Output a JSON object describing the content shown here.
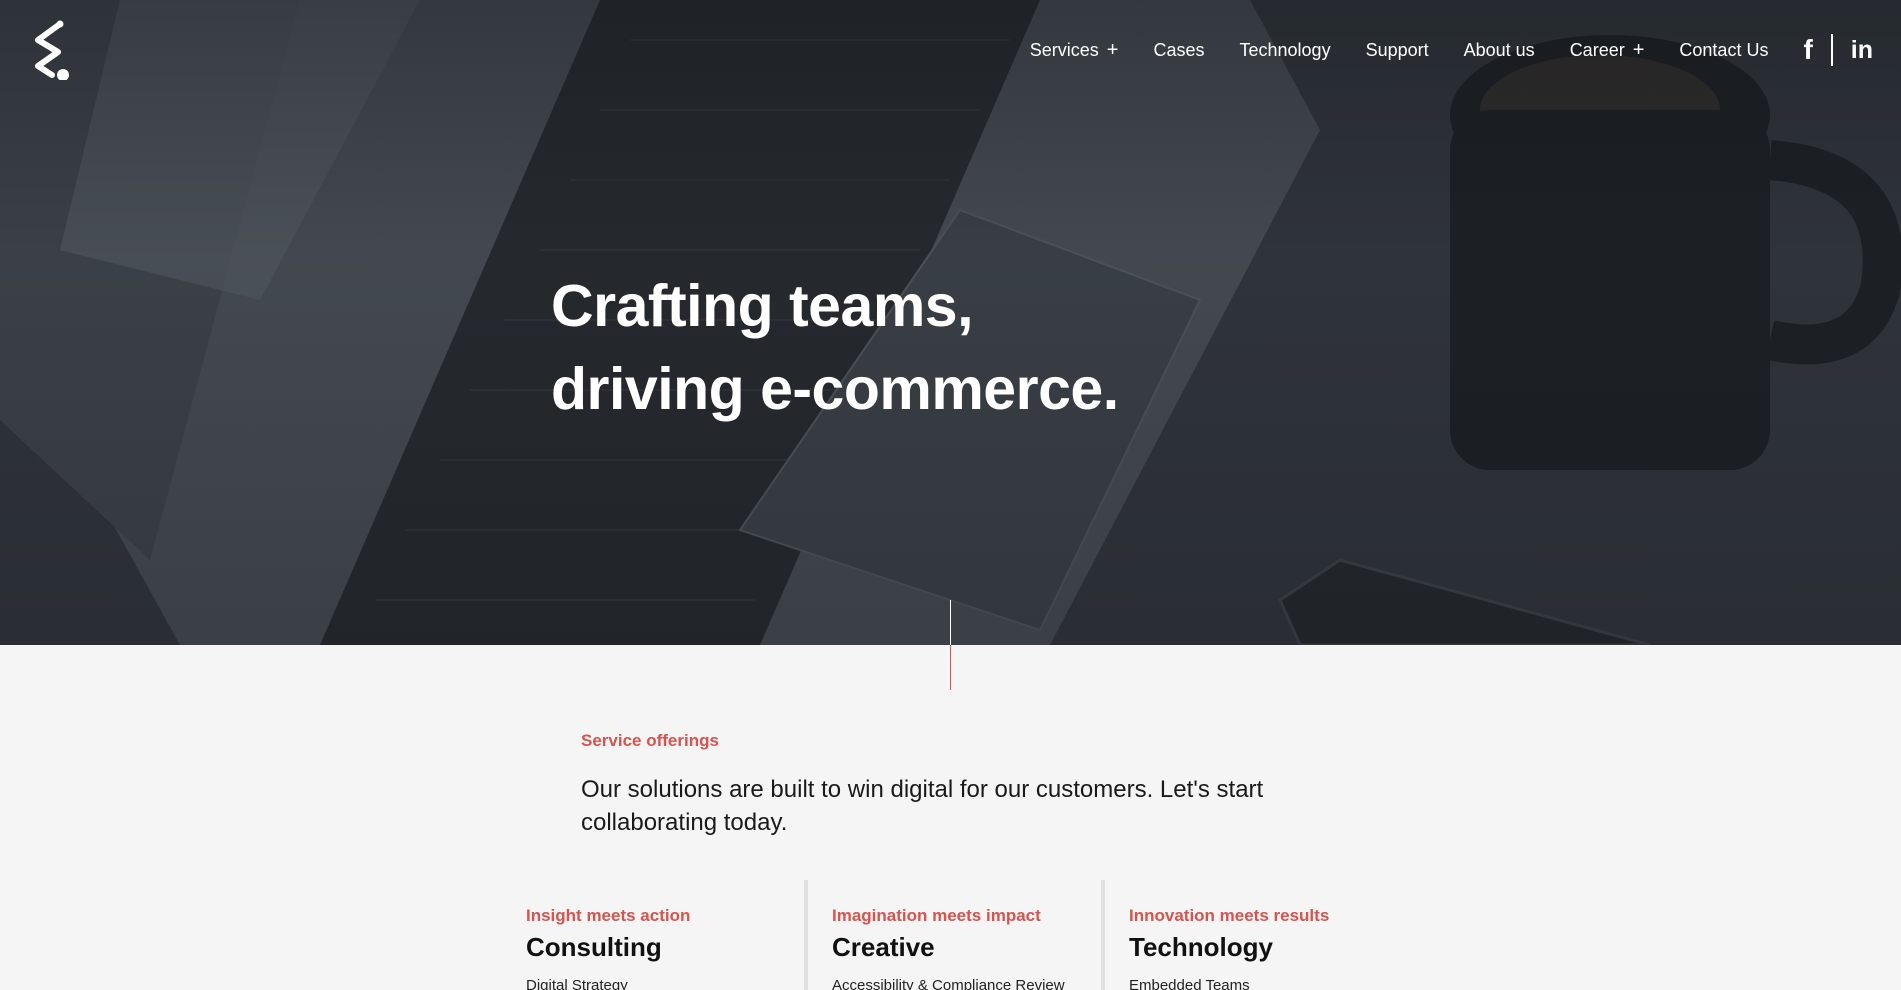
{
  "header": {
    "logo_name": "company-logo",
    "nav": [
      {
        "label": "Services",
        "has_submenu": true,
        "submenu_icon": "+"
      },
      {
        "label": "Cases",
        "has_submenu": false
      },
      {
        "label": "Technology",
        "has_submenu": false
      },
      {
        "label": "Support",
        "has_submenu": false
      },
      {
        "label": "About us",
        "has_submenu": false
      },
      {
        "label": "Career",
        "has_submenu": true,
        "submenu_icon": "+"
      },
      {
        "label": "Contact Us",
        "has_submenu": false
      }
    ],
    "social": {
      "facebook_glyph": "f",
      "linkedin_glyph": "in"
    }
  },
  "hero": {
    "title_line1": "Crafting teams,",
    "title_line2": "driving e-commerce."
  },
  "services": {
    "eyebrow": "Service offerings",
    "intro": "Our solutions are built to win digital for our customers. Let's start collaborating today.",
    "columns": [
      {
        "tag": "Insight meets action",
        "title": "Consulting",
        "first_item": "Digital Strategy"
      },
      {
        "tag": "Imagination meets impact",
        "title": "Creative",
        "first_item": "Accessibility & Compliance Review"
      },
      {
        "tag": "Innovation meets results",
        "title": "Technology",
        "first_item": "Embedded Teams"
      }
    ]
  },
  "colors": {
    "accent": "#d9534f",
    "hero_overlay": "#2a2e33",
    "section_bg": "#f5f5f5"
  }
}
